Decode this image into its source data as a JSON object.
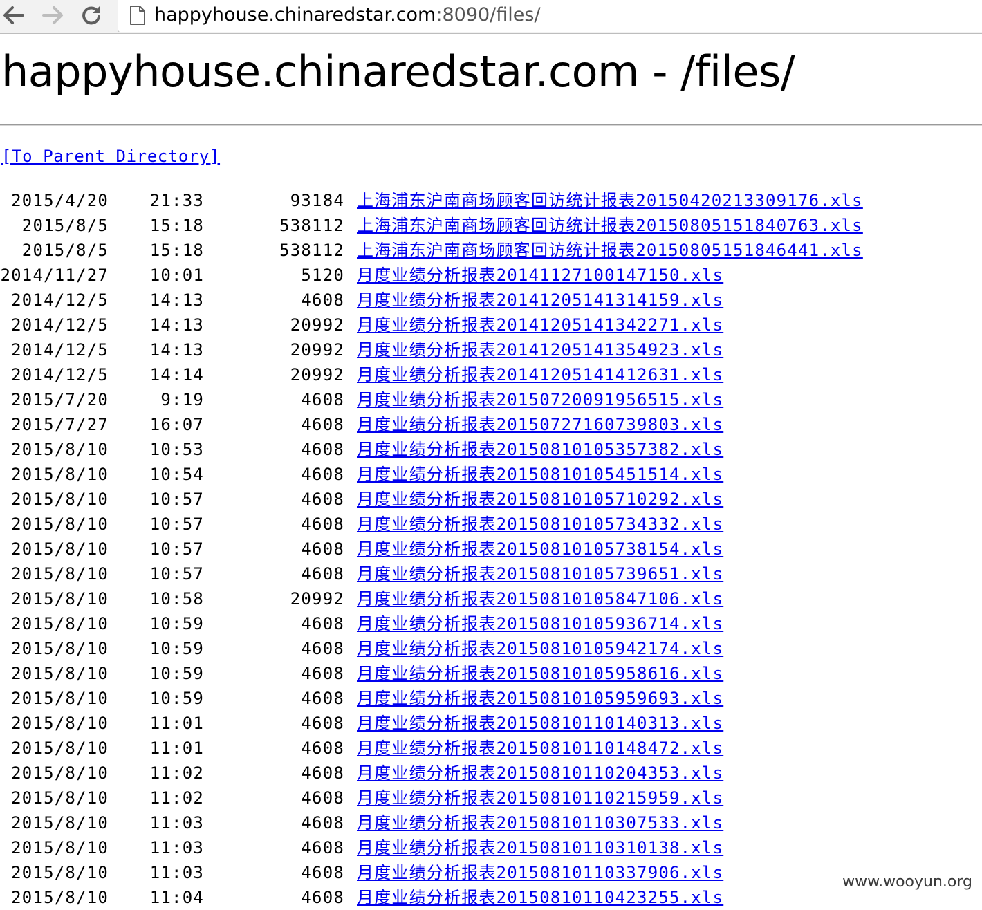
{
  "browser": {
    "url_host": "happyhouse.chinaredstar.com",
    "url_rest": ":8090/files/"
  },
  "page": {
    "heading": "happyhouse.chinaredstar.com - /files/",
    "parent_link": "[To Parent Directory]"
  },
  "files": [
    {
      "date": "2015/4/20",
      "time": "21:33",
      "size": "93184",
      "name": "上海浦东沪南商场顾客回访统计报表20150420213309176.xls"
    },
    {
      "date": "2015/8/5",
      "time": "15:18",
      "size": "538112",
      "name": "上海浦东沪南商场顾客回访统计报表20150805151840763.xls"
    },
    {
      "date": "2015/8/5",
      "time": "15:18",
      "size": "538112",
      "name": "上海浦东沪南商场顾客回访统计报表20150805151846441.xls"
    },
    {
      "date": "2014/11/27",
      "time": "10:01",
      "size": "5120",
      "name": "月度业绩分析报表20141127100147150.xls"
    },
    {
      "date": "2014/12/5",
      "time": "14:13",
      "size": "4608",
      "name": "月度业绩分析报表20141205141314159.xls"
    },
    {
      "date": "2014/12/5",
      "time": "14:13",
      "size": "20992",
      "name": "月度业绩分析报表20141205141342271.xls"
    },
    {
      "date": "2014/12/5",
      "time": "14:13",
      "size": "20992",
      "name": "月度业绩分析报表20141205141354923.xls"
    },
    {
      "date": "2014/12/5",
      "time": "14:14",
      "size": "20992",
      "name": "月度业绩分析报表20141205141412631.xls"
    },
    {
      "date": "2015/7/20",
      "time": "9:19",
      "size": "4608",
      "name": "月度业绩分析报表20150720091956515.xls"
    },
    {
      "date": "2015/7/27",
      "time": "16:07",
      "size": "4608",
      "name": "月度业绩分析报表20150727160739803.xls"
    },
    {
      "date": "2015/8/10",
      "time": "10:53",
      "size": "4608",
      "name": "月度业绩分析报表20150810105357382.xls"
    },
    {
      "date": "2015/8/10",
      "time": "10:54",
      "size": "4608",
      "name": "月度业绩分析报表20150810105451514.xls"
    },
    {
      "date": "2015/8/10",
      "time": "10:57",
      "size": "4608",
      "name": "月度业绩分析报表20150810105710292.xls"
    },
    {
      "date": "2015/8/10",
      "time": "10:57",
      "size": "4608",
      "name": "月度业绩分析报表20150810105734332.xls"
    },
    {
      "date": "2015/8/10",
      "time": "10:57",
      "size": "4608",
      "name": "月度业绩分析报表20150810105738154.xls"
    },
    {
      "date": "2015/8/10",
      "time": "10:57",
      "size": "4608",
      "name": "月度业绩分析报表20150810105739651.xls"
    },
    {
      "date": "2015/8/10",
      "time": "10:58",
      "size": "20992",
      "name": "月度业绩分析报表20150810105847106.xls"
    },
    {
      "date": "2015/8/10",
      "time": "10:59",
      "size": "4608",
      "name": "月度业绩分析报表20150810105936714.xls"
    },
    {
      "date": "2015/8/10",
      "time": "10:59",
      "size": "4608",
      "name": "月度业绩分析报表20150810105942174.xls"
    },
    {
      "date": "2015/8/10",
      "time": "10:59",
      "size": "4608",
      "name": "月度业绩分析报表20150810105958616.xls"
    },
    {
      "date": "2015/8/10",
      "time": "10:59",
      "size": "4608",
      "name": "月度业绩分析报表20150810105959693.xls"
    },
    {
      "date": "2015/8/10",
      "time": "11:01",
      "size": "4608",
      "name": "月度业绩分析报表20150810110140313.xls"
    },
    {
      "date": "2015/8/10",
      "time": "11:01",
      "size": "4608",
      "name": "月度业绩分析报表20150810110148472.xls"
    },
    {
      "date": "2015/8/10",
      "time": "11:02",
      "size": "4608",
      "name": "月度业绩分析报表20150810110204353.xls"
    },
    {
      "date": "2015/8/10",
      "time": "11:02",
      "size": "4608",
      "name": "月度业绩分析报表20150810110215959.xls"
    },
    {
      "date": "2015/8/10",
      "time": "11:03",
      "size": "4608",
      "name": "月度业绩分析报表20150810110307533.xls"
    },
    {
      "date": "2015/8/10",
      "time": "11:03",
      "size": "4608",
      "name": "月度业绩分析报表20150810110310138.xls"
    },
    {
      "date": "2015/8/10",
      "time": "11:03",
      "size": "4608",
      "name": "月度业绩分析报表20150810110337906.xls"
    },
    {
      "date": "2015/8/10",
      "time": "11:04",
      "size": "4608",
      "name": "月度业绩分析报表20150810110423255.xls"
    }
  ],
  "watermark": "www.wooyun.org",
  "colors": {
    "link": "#0000ee",
    "toolbar_bg": "#f2f2f2"
  }
}
